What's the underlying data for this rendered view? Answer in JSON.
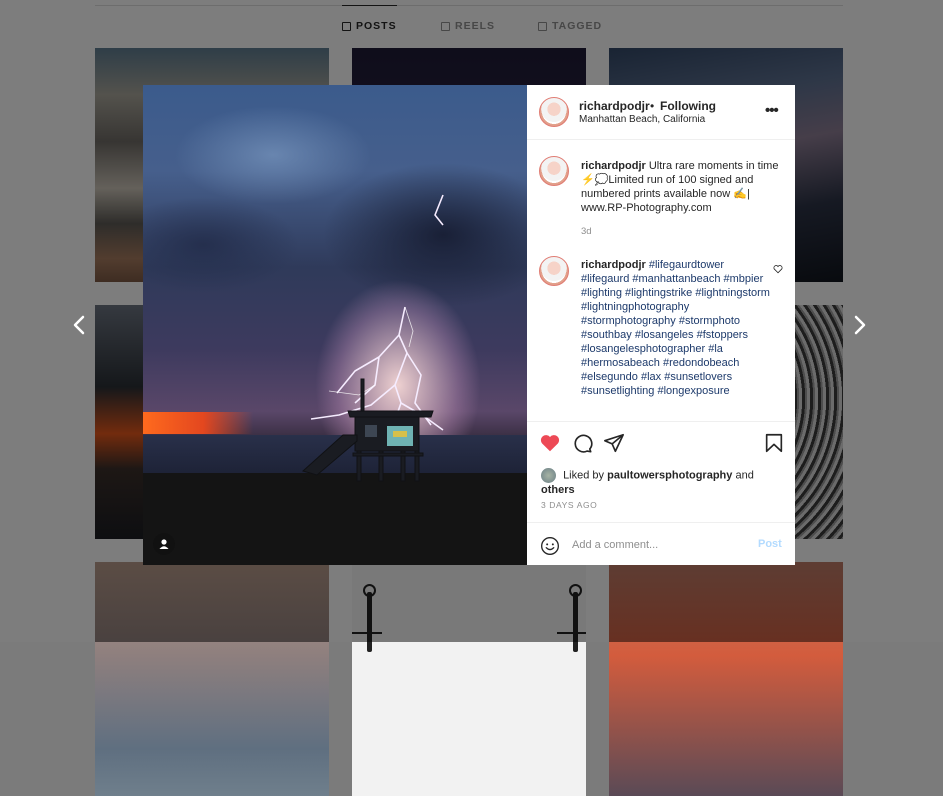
{
  "profile_tabs": [
    {
      "label": "POSTS",
      "active": true
    },
    {
      "label": "REELS",
      "active": false
    },
    {
      "label": "TAGGED",
      "active": false
    }
  ],
  "modal": {
    "header": {
      "username": "richardpodjr",
      "separator": "•",
      "follow_status": "Following",
      "location": "Manhattan Beach, California",
      "more_icon": "more-horizontal-icon"
    },
    "caption": {
      "username": "richardpodjr",
      "text": "Ultra rare moments in time ⚡️💭Limited run of 100 signed and numbered prints available now ✍️| www.RP-Photography.com",
      "age": "3d"
    },
    "hashtag_comment": {
      "username": "richardpodjr",
      "tags": [
        "#lifegaurdtower",
        "#lifegaurd",
        "#manhattanbeach",
        "#mbpier",
        "#lighting",
        "#lightingstrike",
        "#lightningstorm",
        "#lightningphotography",
        "#stormphotography",
        "#stormphoto",
        "#southbay",
        "#losangeles",
        "#fstoppers",
        "#losangelesphotographer",
        "#la",
        "#hermosabeach",
        "#redondobeach",
        "#elsegundo",
        "#lax",
        "#sunsetlovers",
        "#sunsetlighting",
        "#longexposure"
      ]
    },
    "likes": {
      "prefix": "Liked by",
      "user": "paultowersphotography",
      "joiner": "and",
      "others": "others"
    },
    "posted": "3 DAYS AGO",
    "comment_box": {
      "placeholder": "Add a comment...",
      "post_label": "Post"
    },
    "liked": true,
    "accent": "#ed4956",
    "link_color": "#1d3a6b"
  }
}
